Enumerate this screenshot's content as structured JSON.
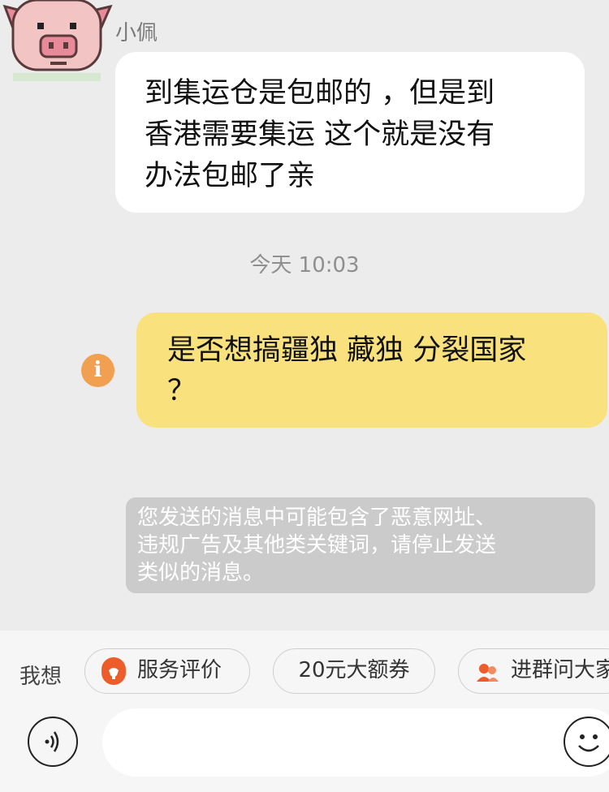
{
  "chat": {
    "incoming": {
      "sender_name": "小佩",
      "lines": [
        "到集运仓是包邮的 ，但是到",
        "香港需要集运 这个就是没有",
        "办法包邮了亲"
      ]
    },
    "timestamp": "今天 10:03",
    "outgoing": {
      "lines": [
        "是否想搞疆独 藏独 分裂国家",
        "？"
      ],
      "status_icon": "info-icon",
      "status_glyph": "i"
    },
    "system_notice": {
      "lines": [
        "您发送的消息中可能包含了恶意网址、",
        "违规广告及其他类关键词，请停止发送",
        "类似的消息。"
      ]
    }
  },
  "quick_actions": {
    "label": "我想",
    "chips": [
      {
        "label": "服务评价",
        "icon": "rate-icon"
      },
      {
        "label": "20元大额券",
        "icon": ""
      },
      {
        "label": "进群问大家",
        "icon": "group-icon"
      }
    ]
  },
  "composer": {
    "voice_icon": "voice-icon",
    "emoji_icon": "emoji-icon",
    "placeholder": ""
  },
  "colors": {
    "background": "#ececec",
    "incoming_bubble": "#ffffff",
    "outgoing_bubble": "#f9e27e",
    "notice_bubble": "#cbcbcb",
    "warning_icon": "#f0a050",
    "accent": "#ec5d2b"
  }
}
